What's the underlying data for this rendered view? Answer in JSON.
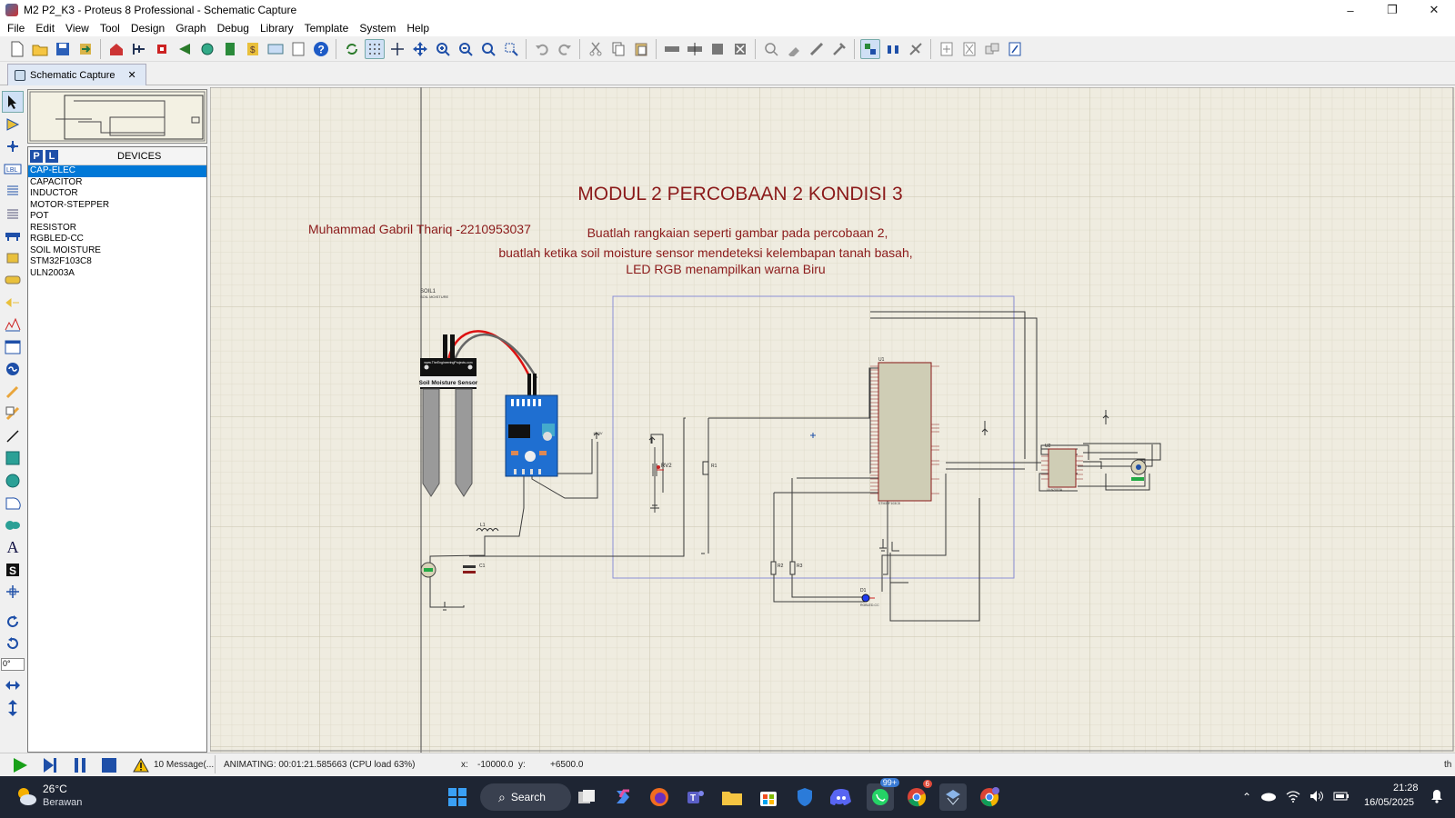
{
  "window": {
    "title": "M2 P2_K3 - Proteus 8 Professional - Schematic Capture",
    "controls": [
      "–",
      "❐",
      "✕"
    ]
  },
  "menu": [
    "File",
    "Edit",
    "View",
    "Tool",
    "Design",
    "Graph",
    "Debug",
    "Library",
    "Template",
    "System",
    "Help"
  ],
  "tab": {
    "label": "Schematic Capture",
    "close": "✕"
  },
  "device_panel": {
    "p_button": "P",
    "l_button": "L",
    "title": "DEVICES",
    "items": [
      "CAP-ELEC",
      "CAPACITOR",
      "INDUCTOR",
      "MOTOR-STEPPER",
      "POT",
      "RESISTOR",
      "RGBLED-CC",
      "SOIL MOISTURE",
      "STM32F103C8",
      "ULN2003A"
    ],
    "selected_index": 0
  },
  "rotation": {
    "value": "0°"
  },
  "schematic": {
    "heading": "MODUL 2 PERCOBAAN 2 KONDISI 3",
    "author": "Muhammad Gabril Thariq -2210953037",
    "instruction_1": "Buatlah rangkaian seperti gambar pada percobaan 2,",
    "instruction_2": "buatlah ketika soil moisture sensor mendeteksi kelembapan tanah basah,",
    "instruction_3": "LED RGB menampilkan warna Biru",
    "sensor_ref": "SOIL1",
    "sensor_value": "SOIL MOISTURE",
    "sensor_site": "www.TheEngineeringProjects.com",
    "sensor_label": "Soil Moisture Sensor",
    "mcu_ref": "U1",
    "mcu_value": "STM32F103C8",
    "driver_ref": "U2",
    "driver_value": "ULN2003A",
    "r1": "R1",
    "r2": "R2",
    "r3": "R3",
    "rv": "RV2",
    "c1": "C1",
    "l1": "L1",
    "d1": "D1",
    "d1_value": "RGBLED-CC",
    "vcc": "+3.3V"
  },
  "status": {
    "messages": "10 Message(...",
    "animating": "ANIMATING: 00:01:21.585663 (CPU load 63%)",
    "x_label": "x:",
    "x_value": "-10000.0",
    "y_label": "y:",
    "y_value": "+6500.0",
    "right": "th"
  },
  "taskbar": {
    "temperature": "26°C",
    "weather": "Berawan",
    "search": "Search",
    "whatsapp_badge": "99+",
    "chrome_badge": "6",
    "time": "21:28",
    "date": "16/05/2025"
  },
  "colors": {
    "canvas": "#efece0",
    "grid": "#d8d4c2",
    "text_red": "#8b1a1a",
    "selected": "#0078d7",
    "taskbar": "#1e2533"
  }
}
